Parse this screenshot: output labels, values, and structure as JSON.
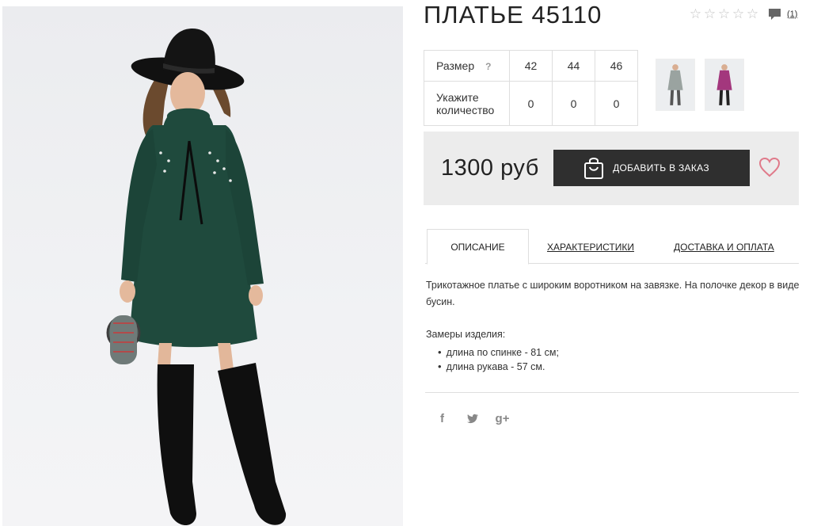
{
  "product": {
    "title": "ПЛАТЬЕ 45110",
    "rating": {
      "stars_filled": 0,
      "stars_total": 5,
      "reviews": "(1)"
    },
    "thumbnails": [
      {
        "name": "thumbnail-grey-dress",
        "color": "#9aa3a0"
      },
      {
        "name": "thumbnail-magenta-dress",
        "color": "#a3377d"
      }
    ]
  },
  "size_table": {
    "size_label": "Размер",
    "help": "?",
    "sizes": [
      "42",
      "44",
      "46"
    ],
    "qty_label_line1": "Укажите",
    "qty_label_line2": "количество",
    "quantities": [
      "0",
      "0",
      "0"
    ]
  },
  "order": {
    "price": "1300 руб",
    "add_button": "ДОБАВИТЬ В ЗАКАЗ"
  },
  "tabs": [
    {
      "label": "ОПИСАНИЕ",
      "active": true
    },
    {
      "label": "ХАРАКТЕРИСТИКИ",
      "active": false
    },
    {
      "label": "ДОСТАВКА И ОПЛАТА",
      "active": false
    }
  ],
  "description": {
    "text": "Трикотажное платье с широким воротником на завязке. На полочке декор в виде бусин.",
    "measures_title": "Замеры изделия:",
    "measures": [
      "длина по спинке - 81 см;",
      "длина рукава - 57 см."
    ]
  },
  "social": {
    "facebook": "f",
    "twitter": "t",
    "google_plus": "g+"
  },
  "colors": {
    "dress_green": "#1f4a3d",
    "button_dark": "#2f2f2f",
    "heart_pink": "#e07a8a",
    "price_bg": "#ececec"
  }
}
